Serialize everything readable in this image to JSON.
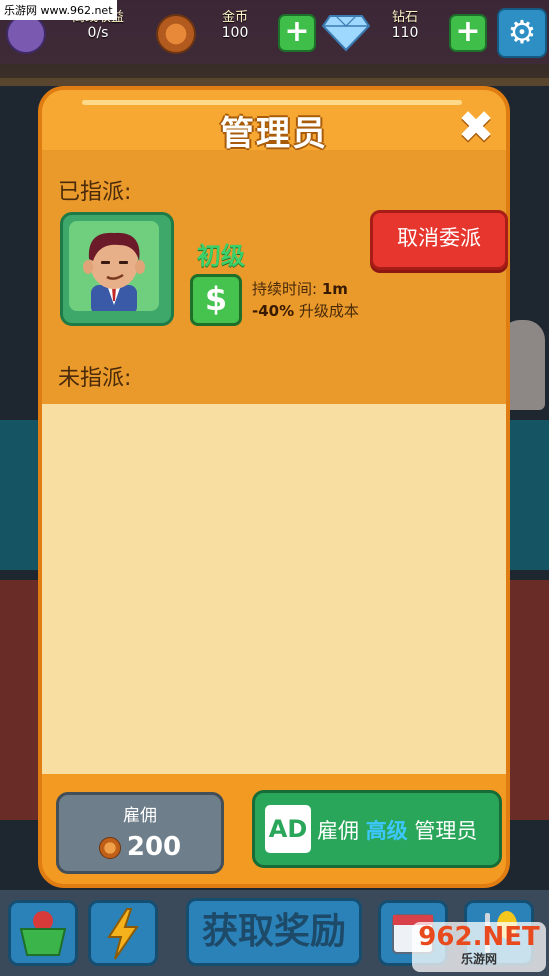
{
  "watermark_top": "乐游网 www.962.net",
  "topbar": {
    "income": {
      "label": "离线收益",
      "value": "0/s"
    },
    "coins": {
      "label": "金币",
      "value": "100"
    },
    "gems": {
      "label": "钻石",
      "value": "110"
    },
    "plus_symbol": "+",
    "settings_icon": "gear-icon"
  },
  "modal": {
    "title": "管理员",
    "close_symbol": "✖",
    "assigned_label": "已指派:",
    "unassigned_label": "未指派:",
    "manager": {
      "rank": "初级",
      "icon_symbol": "$",
      "duration_label": "持续时间: ",
      "duration_value": "1m",
      "discount_value": "-40%",
      "discount_label": " 升级成本"
    },
    "cancel_button": "取消委派",
    "hire": {
      "label": "雇佣",
      "cost": "200"
    },
    "ad_hire": {
      "badge": "AD",
      "prefix": "雇佣 ",
      "highlight": "高级",
      "suffix": " 管理员"
    }
  },
  "bottombar": {
    "rewards_button": "获取奖励"
  },
  "watermark_bottom": {
    "logo": "962.NET",
    "sub": "乐游网"
  },
  "colors": {
    "modal": "#f39a22",
    "list_bg": "#f8dea1",
    "cancel": "#e6362e",
    "ad_button": "#2aa65a",
    "rank": "#3bd06a"
  }
}
